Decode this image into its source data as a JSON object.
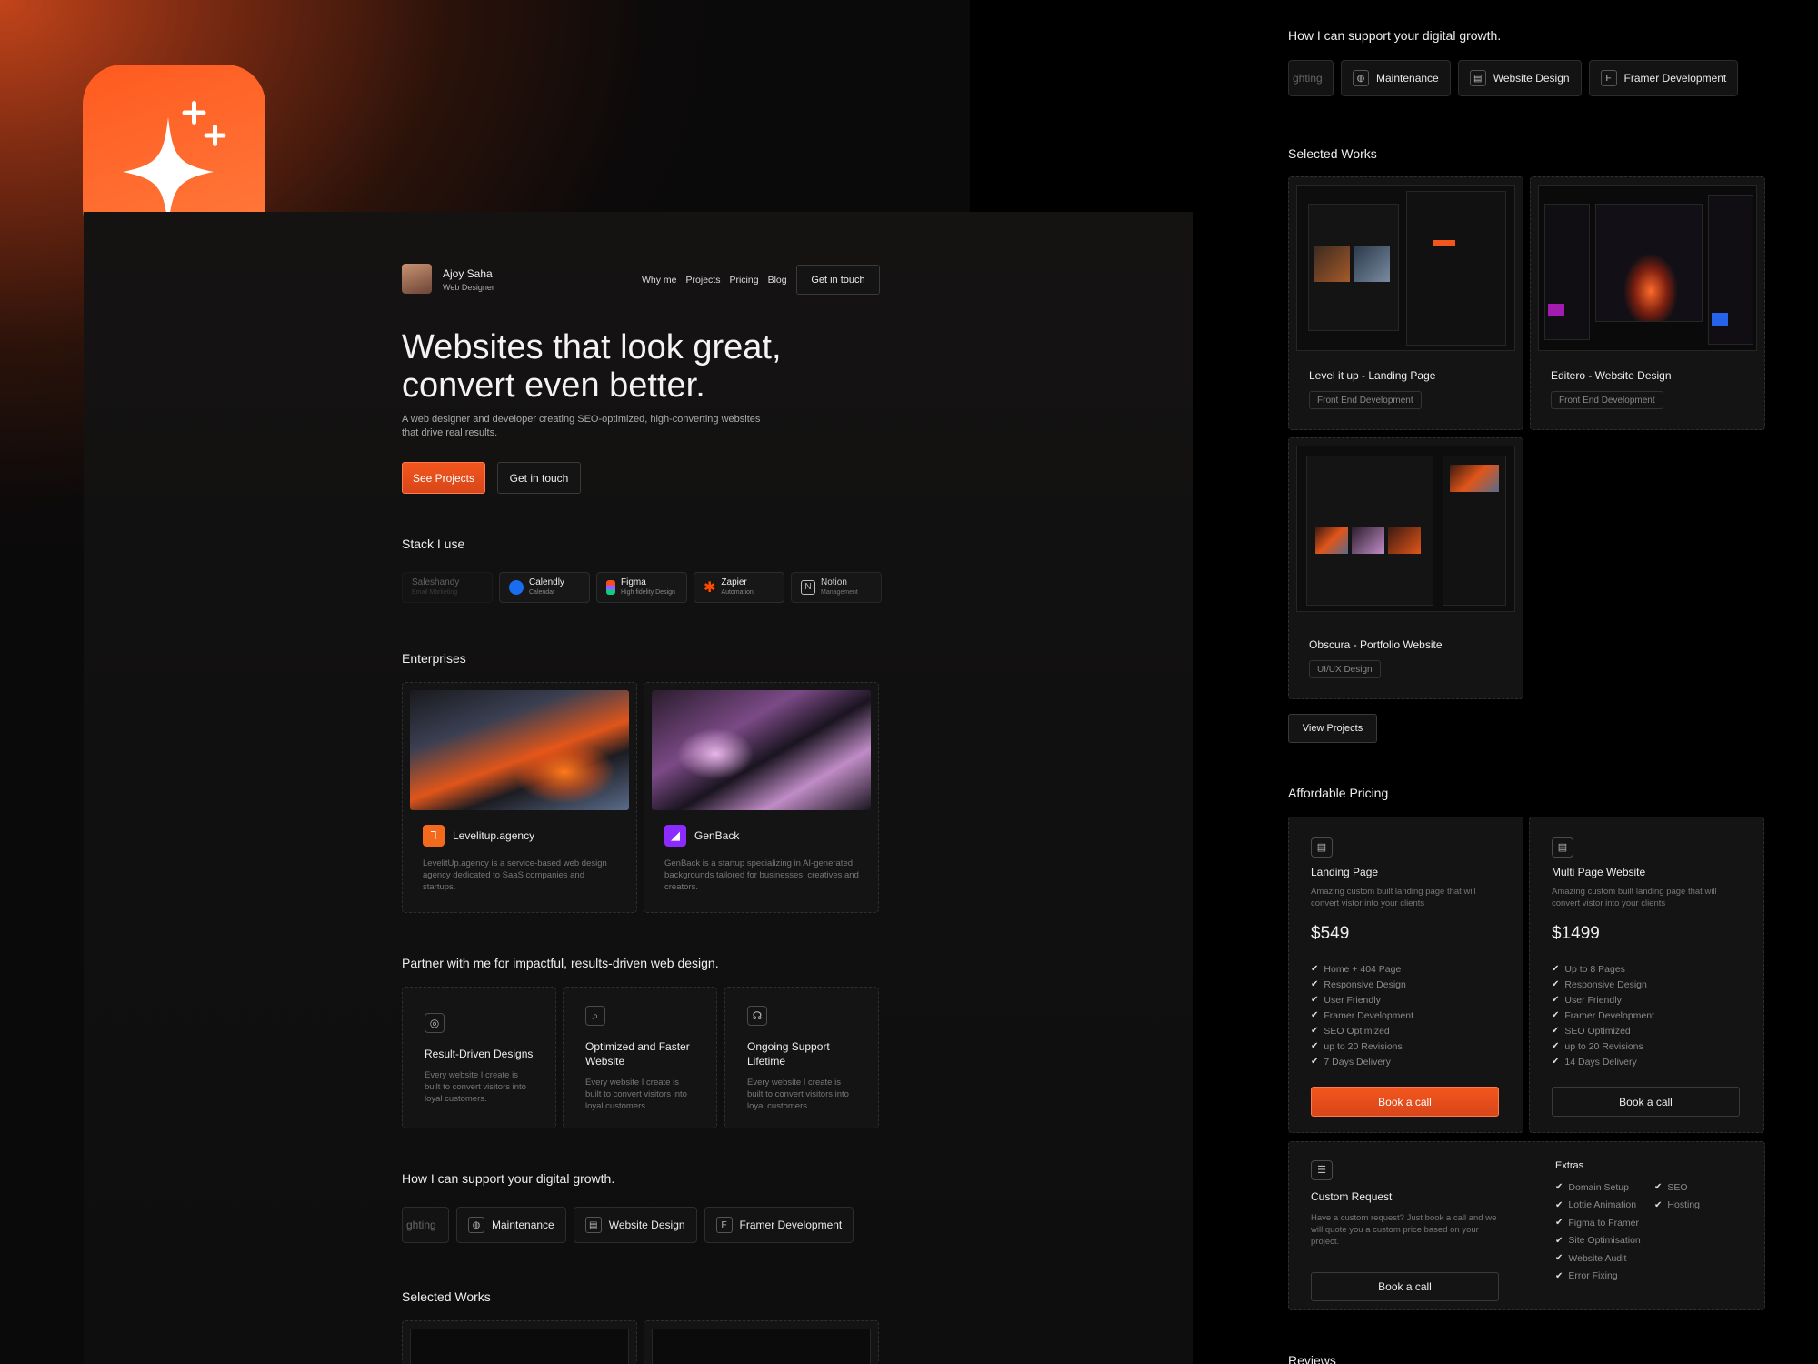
{
  "colors": {
    "accent": "#f2561d",
    "bg": "#0b0b0b",
    "card": "#141414"
  },
  "header": {
    "name": "Ajoy Saha",
    "role": "Web Designer",
    "nav": [
      "Why me",
      "Projects",
      "Pricing",
      "Blog"
    ],
    "cta": "Get in touch"
  },
  "hero": {
    "title_line1": "Websites that look great,",
    "title_line2": "convert even better.",
    "subtitle_line1": "A web designer and developer creating SEO-optimized, high-converting websites",
    "subtitle_line2": "that drive real results.",
    "primary": "See Projects",
    "secondary": "Get in touch"
  },
  "stack": {
    "title": "Stack I use",
    "items": [
      {
        "name": "Saleshandy",
        "desc": "Email Marketing",
        "icon": "saleshandy-icon"
      },
      {
        "name": "Calendly",
        "desc": "Calendar",
        "icon": "calendly-icon"
      },
      {
        "name": "Figma",
        "desc": "High fidelity Design",
        "icon": "figma-icon"
      },
      {
        "name": "Zapier",
        "desc": "Automation",
        "icon": "zapier-icon"
      },
      {
        "name": "Notion",
        "desc": "Management",
        "icon": "notion-icon"
      }
    ]
  },
  "enterprises": {
    "title": "Enterprises",
    "items": [
      {
        "name": "Levelitup.agency",
        "desc": "LevelitUp.agency is a service-based web design agency dedicated to SaaS companies and startups."
      },
      {
        "name": "GenBack",
        "desc": "GenBack is a startup specializing in AI-generated backgrounds tailored for businesses, creatives and creators."
      }
    ]
  },
  "partner": {
    "title": "Partner with me for impactful, results-driven web design.",
    "items": [
      {
        "title": "Result-Driven Designs",
        "desc": "Every website I create is built to convert visitors into loyal customers.",
        "icon": "target-icon"
      },
      {
        "title": "Optimized and Faster Website",
        "desc": "Every website I create is built to convert visitors into loyal customers.",
        "icon": "search-icon"
      },
      {
        "title": "Ongoing Support Lifetime",
        "desc": "Every website I create is built to convert visitors into loyal customers.",
        "icon": "headset-icon"
      }
    ]
  },
  "support": {
    "title": "How I can support your digital growth.",
    "items": [
      "ghting",
      "Maintenance",
      "Website Design",
      "Framer Development"
    ]
  },
  "works": {
    "title": "Selected Works",
    "items": [
      {
        "title": "Level it up - Landing Page",
        "tag": "Front End Development"
      },
      {
        "title": "Editero - Website Design",
        "tag": "Front End Development"
      },
      {
        "title": "Obscura - Portfolio Website",
        "tag": "UI/UX Design"
      }
    ],
    "view": "View Projects"
  },
  "pricing": {
    "title": "Affordable Pricing",
    "plans": [
      {
        "name": "Landing Page",
        "desc": "Amazing custom built landing page that will convert vistor into your clients",
        "price": "$549",
        "features": [
          "Home + 404 Page",
          "Responsive Design",
          "User Friendly",
          "Framer Development",
          "SEO Optimized",
          "up to 20 Revisions",
          "7 Days Delivery"
        ],
        "cta": "Book a call"
      },
      {
        "name": "Multi Page Website",
        "desc": "Amazing custom built landing page that will convert vistor into your clients",
        "price": "$1499",
        "features": [
          "Up to 8 Pages",
          "Responsive Design",
          "User Friendly",
          "Framer Development",
          "SEO Optimized",
          "up to 20 Revisions",
          "14 Days Delivery"
        ],
        "cta": "Book a call"
      }
    ],
    "custom": {
      "name": "Custom Request",
      "desc": "Have a custom request? Just book a call and we will quote you a custom price based on your project.",
      "cta": "Book a call",
      "extras_title": "Extras",
      "extras_col1": [
        "Domain Setup",
        "Lottie Animation",
        "Figma to Framer",
        "Site Optimisation",
        "Website Audit",
        "Error Fixing"
      ],
      "extras_col2": [
        "SEO",
        "Hosting"
      ]
    }
  },
  "reviews": {
    "title": "Reviews"
  }
}
